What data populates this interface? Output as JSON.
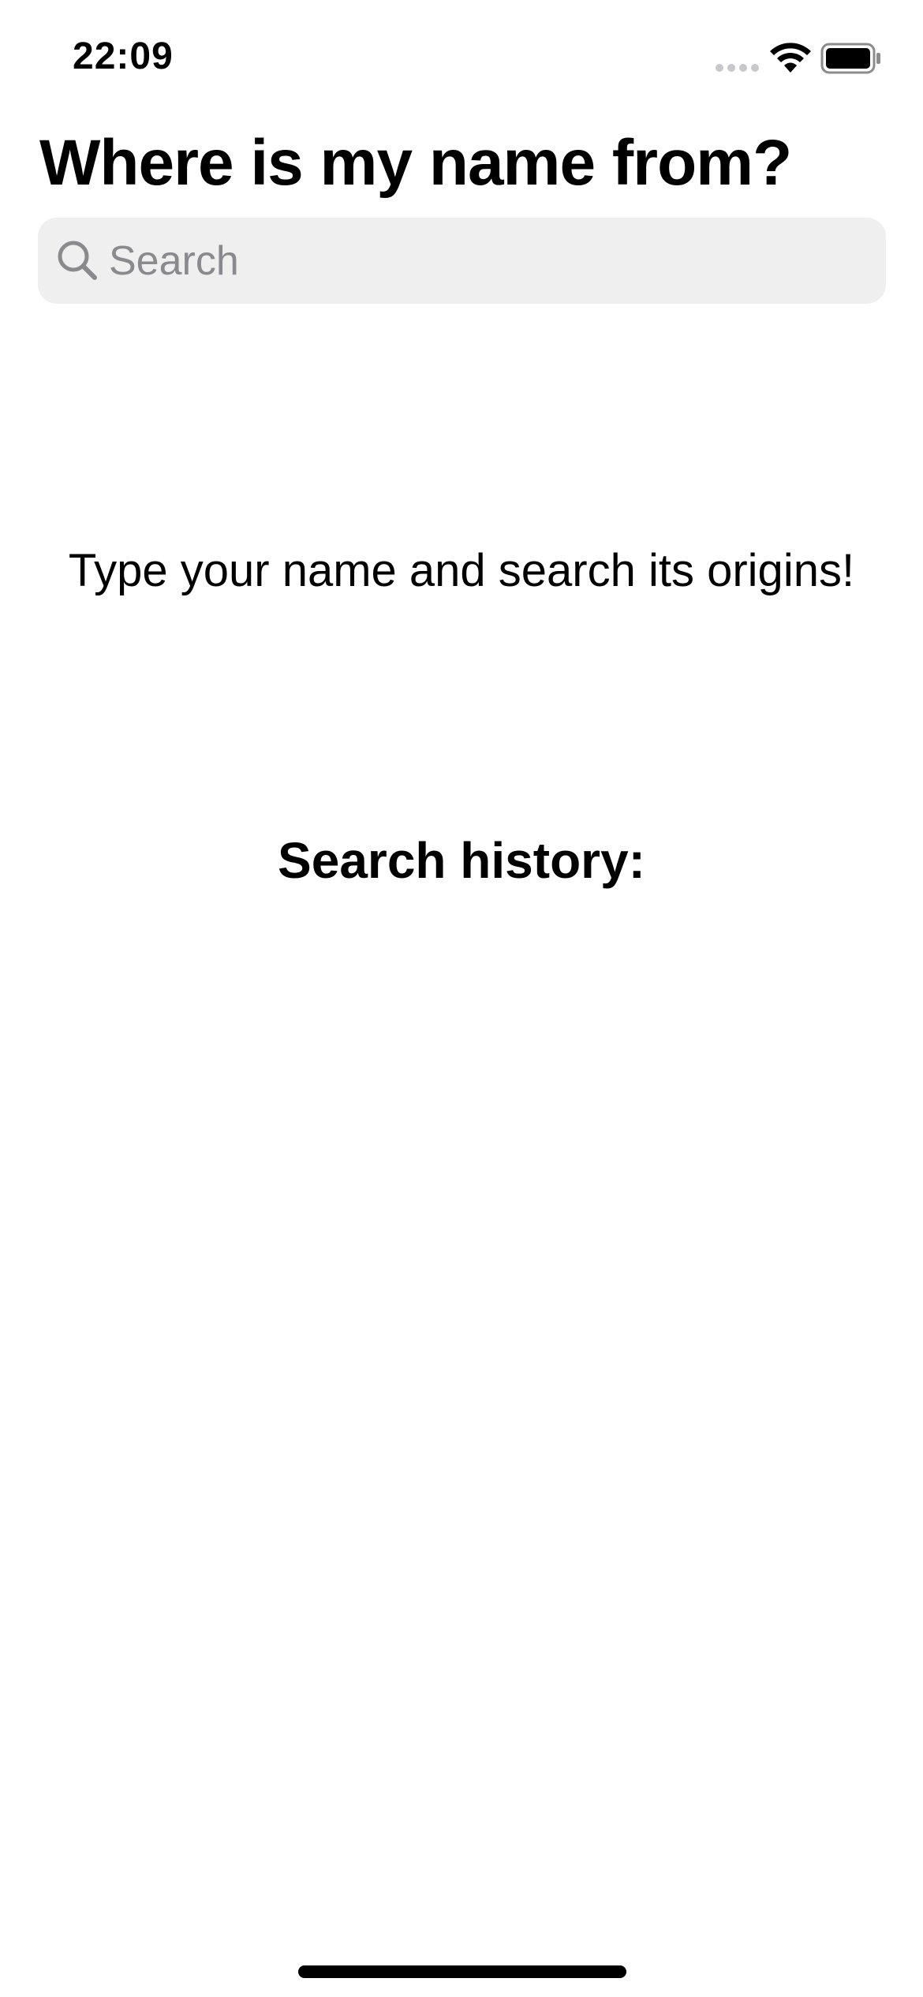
{
  "status_bar": {
    "time": "22:09",
    "icons": [
      "cellular-signal-icon",
      "wifi-icon",
      "battery-icon"
    ]
  },
  "header": {
    "title": "Where is my name from?"
  },
  "search": {
    "placeholder": "Search",
    "value": "",
    "icon": "search-icon"
  },
  "main": {
    "prompt": "Type your name and search its origins!",
    "history_heading": "Search history:",
    "history_items": []
  },
  "colors": {
    "background": "#ffffff",
    "search_field_bg": "#efefef",
    "placeholder": "#8a8a8e",
    "text": "#000000"
  }
}
